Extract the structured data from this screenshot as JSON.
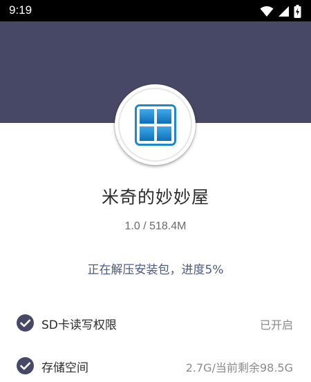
{
  "status_bar": {
    "time": "9:19",
    "icons": [
      "wifi-icon",
      "cellular-signal-icon",
      "battery-charging-icon"
    ]
  },
  "colors": {
    "header_band": "#474866",
    "progress_text": "#4b5a80",
    "check_icon": "#474866",
    "app_icon_blue": "#1a8ad0"
  },
  "app": {
    "icon": "windows-tile-icon",
    "name": "米奇的妙妙屋",
    "version_size": "1.0 / 518.4M"
  },
  "install": {
    "status_text": "正在解压安装包，进度5%",
    "progress_percent": 5
  },
  "checks": [
    {
      "icon": "check-circle-icon",
      "label": "SD卡读写权限",
      "status": "已开启"
    },
    {
      "icon": "check-circle-icon",
      "label": "存储空间",
      "status": "2.7G/当前剩余98.5G"
    }
  ]
}
